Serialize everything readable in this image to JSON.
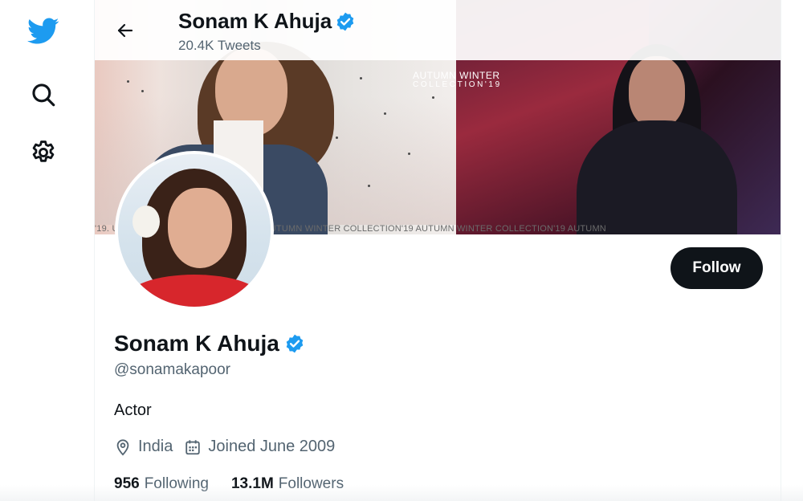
{
  "nav": {
    "logo_icon": "twitter-bird-icon",
    "search_icon": "search-icon",
    "settings_icon": "gear-icon",
    "brand_color": "#1d9bf0"
  },
  "header": {
    "name": "Sonam K Ahuja",
    "tweet_count": "20.4K Tweets",
    "back_icon": "arrow-left-icon"
  },
  "banner": {
    "title_line1": "AUTUMN WINTER",
    "title_line2": "COLLECTION'19",
    "strip_text": "'19.                                           UTUMN WINTER COLLECTION'19 · AUTUMN WINTER COLLECTION'19 AUTUMN WINTER COLLECTION'19 AUTUMN"
  },
  "profile": {
    "name": "Sonam K Ahuja",
    "handle": "@sonamakapoor",
    "bio": "Actor",
    "location": "India",
    "joined": "Joined June 2009",
    "verified_color": "#1d9bf0",
    "follow_label": "Follow",
    "following_count": "956",
    "following_label": "Following",
    "followers_count": "13.1M",
    "followers_label": "Followers"
  }
}
